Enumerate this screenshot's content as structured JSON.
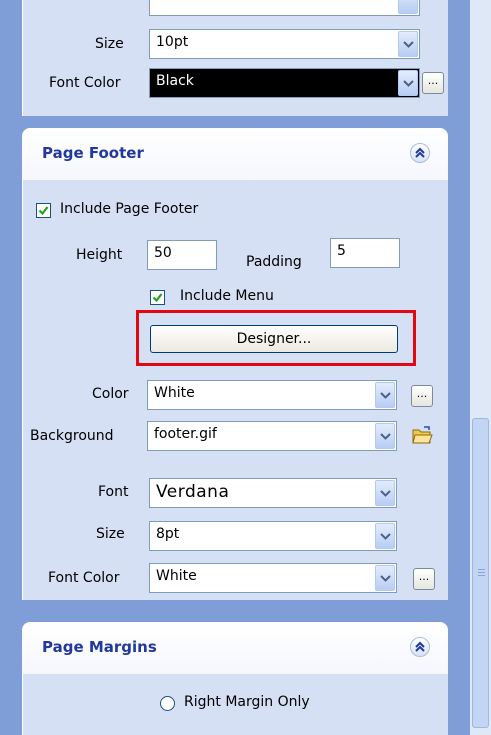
{
  "top_section": {
    "size_label": "Size",
    "size_value": "10pt",
    "font_color_label": "Font Color",
    "font_color_value": "Black",
    "ellipsis": "..."
  },
  "page_footer": {
    "title": "Page Footer",
    "include_footer_label": "Include Page Footer",
    "include_footer_checked": true,
    "height_label": "Height",
    "height_value": "50",
    "padding_label": "Padding",
    "padding_value": "5",
    "include_menu_label": "Include Menu",
    "include_menu_checked": true,
    "designer_label": "Designer...",
    "color_label": "Color",
    "color_value": "White",
    "background_label": "Background",
    "background_value": "footer.gif",
    "font_label": "Font",
    "font_value": "Verdana",
    "size_label": "Size",
    "size_value": "8pt",
    "font_color_label": "Font Color",
    "font_color_value": "White",
    "ellipsis": "..."
  },
  "page_margins": {
    "title": "Page Margins",
    "right_margin_only_label": "Right Margin Only"
  },
  "colors": {
    "section_title": "#21399c",
    "highlight": "#e30613",
    "panel": "#d6e0f5"
  }
}
